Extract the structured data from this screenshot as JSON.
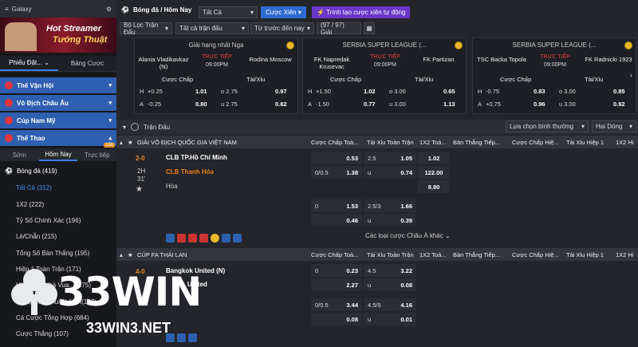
{
  "sidebar": {
    "galaxy": "Galaxy",
    "banner_line1": "Hot Streamer",
    "banner_line2": "Tướng Thuật",
    "tab_bets": "Phiếu Đặt...",
    "tab_ledger": "Bảng Cược",
    "sections": [
      "Thế Vận Hội",
      "Vô Địch Châu Âu",
      "Cúp Nam Mỹ",
      "Thể Thao"
    ],
    "time_tabs": [
      "Sớm",
      "Hôm Nay",
      "Trực tiếp"
    ],
    "live_badge": "156",
    "sport": "Bóng đá (419)",
    "items": [
      "Tất Cả (312)",
      "1X2 (222)",
      "Tỷ Số Chính Xác (196)",
      "Lẻ/Chẵn (215)",
      "Tổng Số Bàn Thắng (195)",
      "Hiệp 1 Toàn Trận (171)",
      "Hiệp Đấu Nhà Vua... (175)",
      "Tỷ Lệ Châu Âu/Châu Á(147)",
      "Cá Cược Tổng Hợp (684)",
      "Cược Thắng (107)"
    ]
  },
  "header": {
    "title": "Bóng đá / Hôm Nay",
    "filter": "Tất Cả",
    "parlay": "Cược Xiên",
    "builder": "Trình tạo cược xiên tự động",
    "league_filter": "Bộ Lọc Trận Đấu",
    "all_matches": "Tất cả trận đấu",
    "sort": "Từ trước đến nay",
    "count": "(97 / 97) Giải"
  },
  "cards": [
    {
      "league": "Giải hạng nhất Nga",
      "home": "Alania Vladikavkaz (N)",
      "away": "Rodina Moscow",
      "live": "TRỰC TIẾP",
      "time": "09:00PM",
      "h_h": "H",
      "h_hc": "+0.25",
      "h_odd": "1.01",
      "h_ou": "o 2.75",
      "h_ouv": "0.97",
      "a_h": "A",
      "a_hc": "-0.25",
      "a_odd": "0.80",
      "a_ou": "u 2.75",
      "a_ouv": "0.82"
    },
    {
      "league": "SERBIA SUPER LEAGUE (...",
      "home": "FK Napredak Krusevac",
      "away": "FK Partizan",
      "live": "TRỰC TIẾP",
      "time": "09:00PM",
      "h_h": "H",
      "h_hc": "+1.50",
      "h_odd": "1.02",
      "h_ou": "o 3.00",
      "h_ouv": "0.65",
      "a_h": "A",
      "a_hc": "-1.50",
      "a_odd": "0.77",
      "a_ou": "u 3.00",
      "a_ouv": "1.13"
    },
    {
      "league": "SERBIA SUPER LEAGUE (...",
      "home": "TSC Backa Topola",
      "away": "FK Radnicki 1923",
      "live": "TRỰC TIẾP",
      "time": "09:00PM",
      "h_h": "H",
      "h_hc": "-0.75",
      "h_odd": "0.83",
      "h_ou": "o 3.00",
      "h_ouv": "0.85",
      "a_h": "A",
      "a_hc": "+0.75",
      "a_odd": "0.96",
      "a_ou": "u 3.00",
      "a_ouv": "0.92"
    }
  ],
  "card_cols": {
    "handicap": "Cược Chấp",
    "ou": "Tài/Xỉu"
  },
  "subbar": {
    "label": "Trận Đấu",
    "select": "Lựa chọn bình thường",
    "mode": "Hai Dòng"
  },
  "columns": [
    "Cược Chấp Toà...",
    "Tài Xỉu Toàn Trận",
    "1X2 Toà...",
    "Bàn Thắng Tiếp...",
    "Cược Chấp Hiệ...",
    "Tài Xỉu Hiệp 1",
    "1X2 Hi"
  ],
  "match1": {
    "league": "GIẢI VÔ ĐỊCH QUỐC GIA VIỆT NAM",
    "score": "2-0",
    "period": "2H",
    "minute": "31'",
    "home": "CLB TP.Hồ Chí Minh",
    "away": "CLB Thanh Hóa",
    "draw": "Hòa",
    "r1": {
      "hc": "",
      "hcv": "0.53",
      "ou": "2.5",
      "ouv": "1.05",
      "x": "1.02"
    },
    "r2": {
      "hc": "0/0.5",
      "hcv": "1.38",
      "ou": "u",
      "ouv": "0.74",
      "x": "122.00"
    },
    "r3": {
      "x": "8.90"
    },
    "r4": {
      "hc": "0",
      "hcv": "1.53",
      "ou": "2.5/3",
      "ouv": "1.66"
    },
    "r5": {
      "hcv": "0.46",
      "ou": "u",
      "ouv": "0.39"
    },
    "more": "Các loại cược Châu Á khác"
  },
  "match2": {
    "league": "CÚP FA THÁI LAN",
    "score": "4-0",
    "home": "Bangkok United (N)",
    "away": "... United",
    "r1": {
      "hc": "0",
      "hcv": "0.23",
      "ou": "4.5",
      "ouv": "3.22"
    },
    "r2": {
      "hcv": "2.27",
      "ou": "u",
      "ouv": "0.08"
    },
    "r3": {
      "hc": "0/0.5",
      "hcv": "3.44",
      "ou": "4.5/5",
      "ouv": "4.16"
    },
    "r4": {
      "hcv": "0.08",
      "ou": "u",
      "ouv": "0.01"
    }
  },
  "logo": {
    "brand": "33WIN",
    "url": "33WIN3.NET"
  },
  "colors": {
    "accent": "#2f5fb0",
    "live": "#e34040",
    "score": "#e88d1a",
    "gold": "#e6b82c"
  }
}
